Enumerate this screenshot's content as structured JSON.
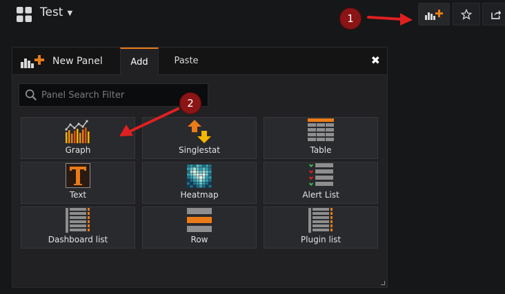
{
  "dashboard": {
    "title": "Test"
  },
  "callouts": {
    "one": "1",
    "two": "2"
  },
  "panel": {
    "title": "New Panel",
    "tabs": [
      {
        "label": "Add",
        "active": true
      },
      {
        "label": "Paste",
        "active": false
      }
    ],
    "search": {
      "placeholder": "Panel Search Filter",
      "value": ""
    },
    "types": [
      {
        "label": "Graph",
        "icon": "graph-icon"
      },
      {
        "label": "Singlestat",
        "icon": "singlestat-icon"
      },
      {
        "label": "Table",
        "icon": "table-icon"
      },
      {
        "label": "Text",
        "icon": "text-icon"
      },
      {
        "label": "Heatmap",
        "icon": "heatmap-icon"
      },
      {
        "label": "Alert List",
        "icon": "alert-list-icon"
      },
      {
        "label": "Dashboard list",
        "icon": "dashboard-list-icon"
      },
      {
        "label": "Row",
        "icon": "row-icon"
      },
      {
        "label": "Plugin list",
        "icon": "plugin-list-icon"
      }
    ]
  },
  "colors": {
    "accent": "#eb7b18",
    "callout": "#8b1414",
    "arrow": "#e02020",
    "background": "#161719",
    "panel": "#212124"
  }
}
